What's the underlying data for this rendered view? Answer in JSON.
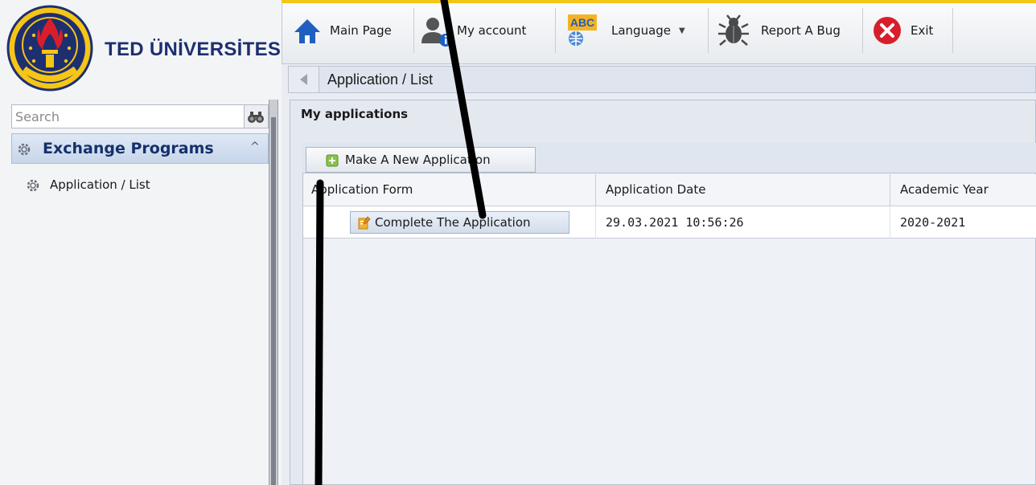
{
  "brand": {
    "name": "TED ÜNİVERSİTESİ",
    "colors": {
      "navy": "#1d2f6f",
      "accent_yellow": "#f5c518",
      "red": "#d81e2b"
    }
  },
  "sidebar": {
    "search": {
      "placeholder": "Search",
      "button_icon": "binoculars-icon"
    },
    "section": {
      "label": "Exchange Programs",
      "icon": "gear-icon",
      "caret": "^"
    },
    "items": [
      {
        "label": "Application /  List",
        "icon": "gear-icon"
      }
    ]
  },
  "toolbar": {
    "buttons": [
      {
        "label": "Main Page",
        "icon": "home-icon"
      },
      {
        "label": "My account",
        "icon": "user-info-icon"
      },
      {
        "label": "Language",
        "icon": "language-abc-icon",
        "badge": "ABC",
        "caret": "▼"
      },
      {
        "label": "Report A Bug",
        "icon": "bug-icon"
      },
      {
        "label": "Exit",
        "icon": "exit-icon"
      }
    ]
  },
  "breadcrumb": {
    "text": "Application / List"
  },
  "panel": {
    "title": "My applications",
    "new_button": "Make A New Application",
    "columns": [
      "Application Form",
      "Application Date",
      "Academic Year"
    ],
    "rows": [
      {
        "action": "Complete The Application",
        "date": "29.03.2021 10:56:26",
        "year": "2020-2021"
      }
    ]
  }
}
